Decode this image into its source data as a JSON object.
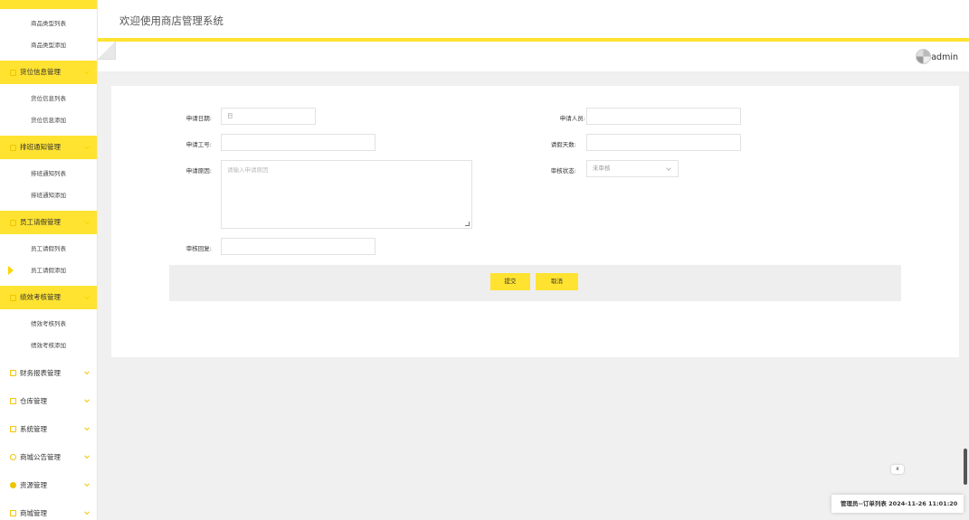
{
  "header": {
    "title": "欢迎使用商店管理系统",
    "username": "admin"
  },
  "sidebar": {
    "items": [
      {
        "label": "商品类型列表"
      },
      {
        "label": "商品类型添加"
      },
      {
        "label": "货位信息管理"
      },
      {
        "label": "货位信息列表"
      },
      {
        "label": "货位信息添加"
      },
      {
        "label": "排班通知管理"
      },
      {
        "label": "排班通知列表"
      },
      {
        "label": "排班通知添加"
      },
      {
        "label": "员工请假管理"
      },
      {
        "label": "员工请假列表"
      },
      {
        "label": "员工请假添加"
      },
      {
        "label": "绩效考核管理"
      },
      {
        "label": "绩效考核列表"
      },
      {
        "label": "绩效考核添加"
      },
      {
        "label": "财务报表管理"
      },
      {
        "label": "仓库管理"
      },
      {
        "label": "系统管理"
      },
      {
        "label": "商城公告管理"
      },
      {
        "label": "资源管理"
      },
      {
        "label": "商城管理"
      }
    ]
  },
  "form": {
    "date_label": "申请日期:",
    "date_placeholder": "日",
    "person_label": "申请人员:",
    "person_value": "",
    "empno_label": "申请工号:",
    "empno_value": "",
    "days_label": "请假天数:",
    "days_value": "",
    "reason_label": "申请原因:",
    "reason_placeholder": "请输入申请原因",
    "status_label": "审核状态:",
    "status_value": "未审核",
    "reply_label": "审核回复:",
    "reply_value": "",
    "submit_label": "提交",
    "cancel_label": "取消"
  },
  "notice": {
    "close": "x",
    "text": "管理员--订单列表 2024-11-26 11:01:20"
  },
  "colors": {
    "accent": "#ffe330"
  }
}
